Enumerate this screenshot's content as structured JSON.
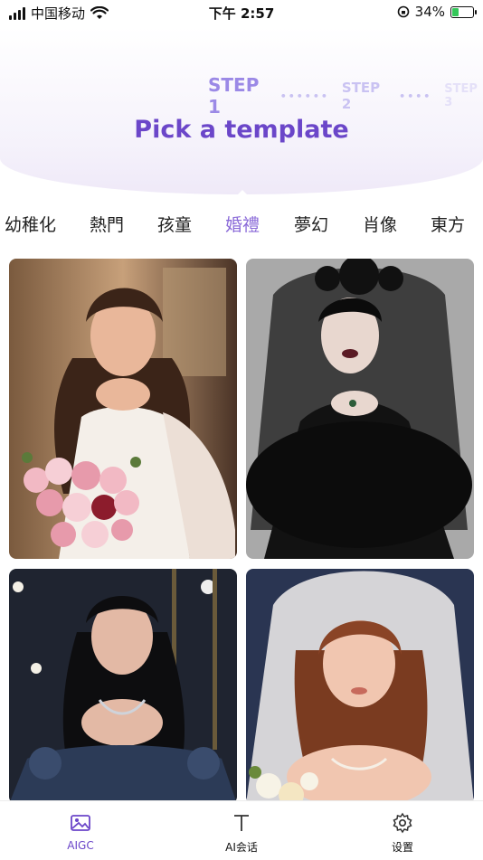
{
  "status_bar": {
    "carrier": "中国移动",
    "time": "下午 2:57",
    "battery_percent": "34%",
    "battery_level": 0.34
  },
  "steps": {
    "step1": "STEP 1",
    "step2": "STEP 2",
    "step3": "STEP 3"
  },
  "title": "Pick a template",
  "tabs": [
    "幼稚化",
    "熱門",
    "孩童",
    "婚禮",
    "夢幻",
    "肖像",
    "東方"
  ],
  "active_tab_index": 3,
  "templates": [
    {
      "name": "bride-white-dress"
    },
    {
      "name": "bride-black-veil"
    },
    {
      "name": "bride-navy-gown"
    },
    {
      "name": "bride-white-veil"
    }
  ],
  "bottom_nav": {
    "items": [
      {
        "label": "AIGC",
        "icon": "image-icon"
      },
      {
        "label": "AI会话",
        "icon": "text-icon"
      },
      {
        "label": "设置",
        "icon": "gear-icon"
      }
    ],
    "active_index": 0
  },
  "colors": {
    "accent": "#6b46c9",
    "step_active": "#9b89e6",
    "tab_active": "#8a6ad8",
    "battery": "#34c759"
  }
}
